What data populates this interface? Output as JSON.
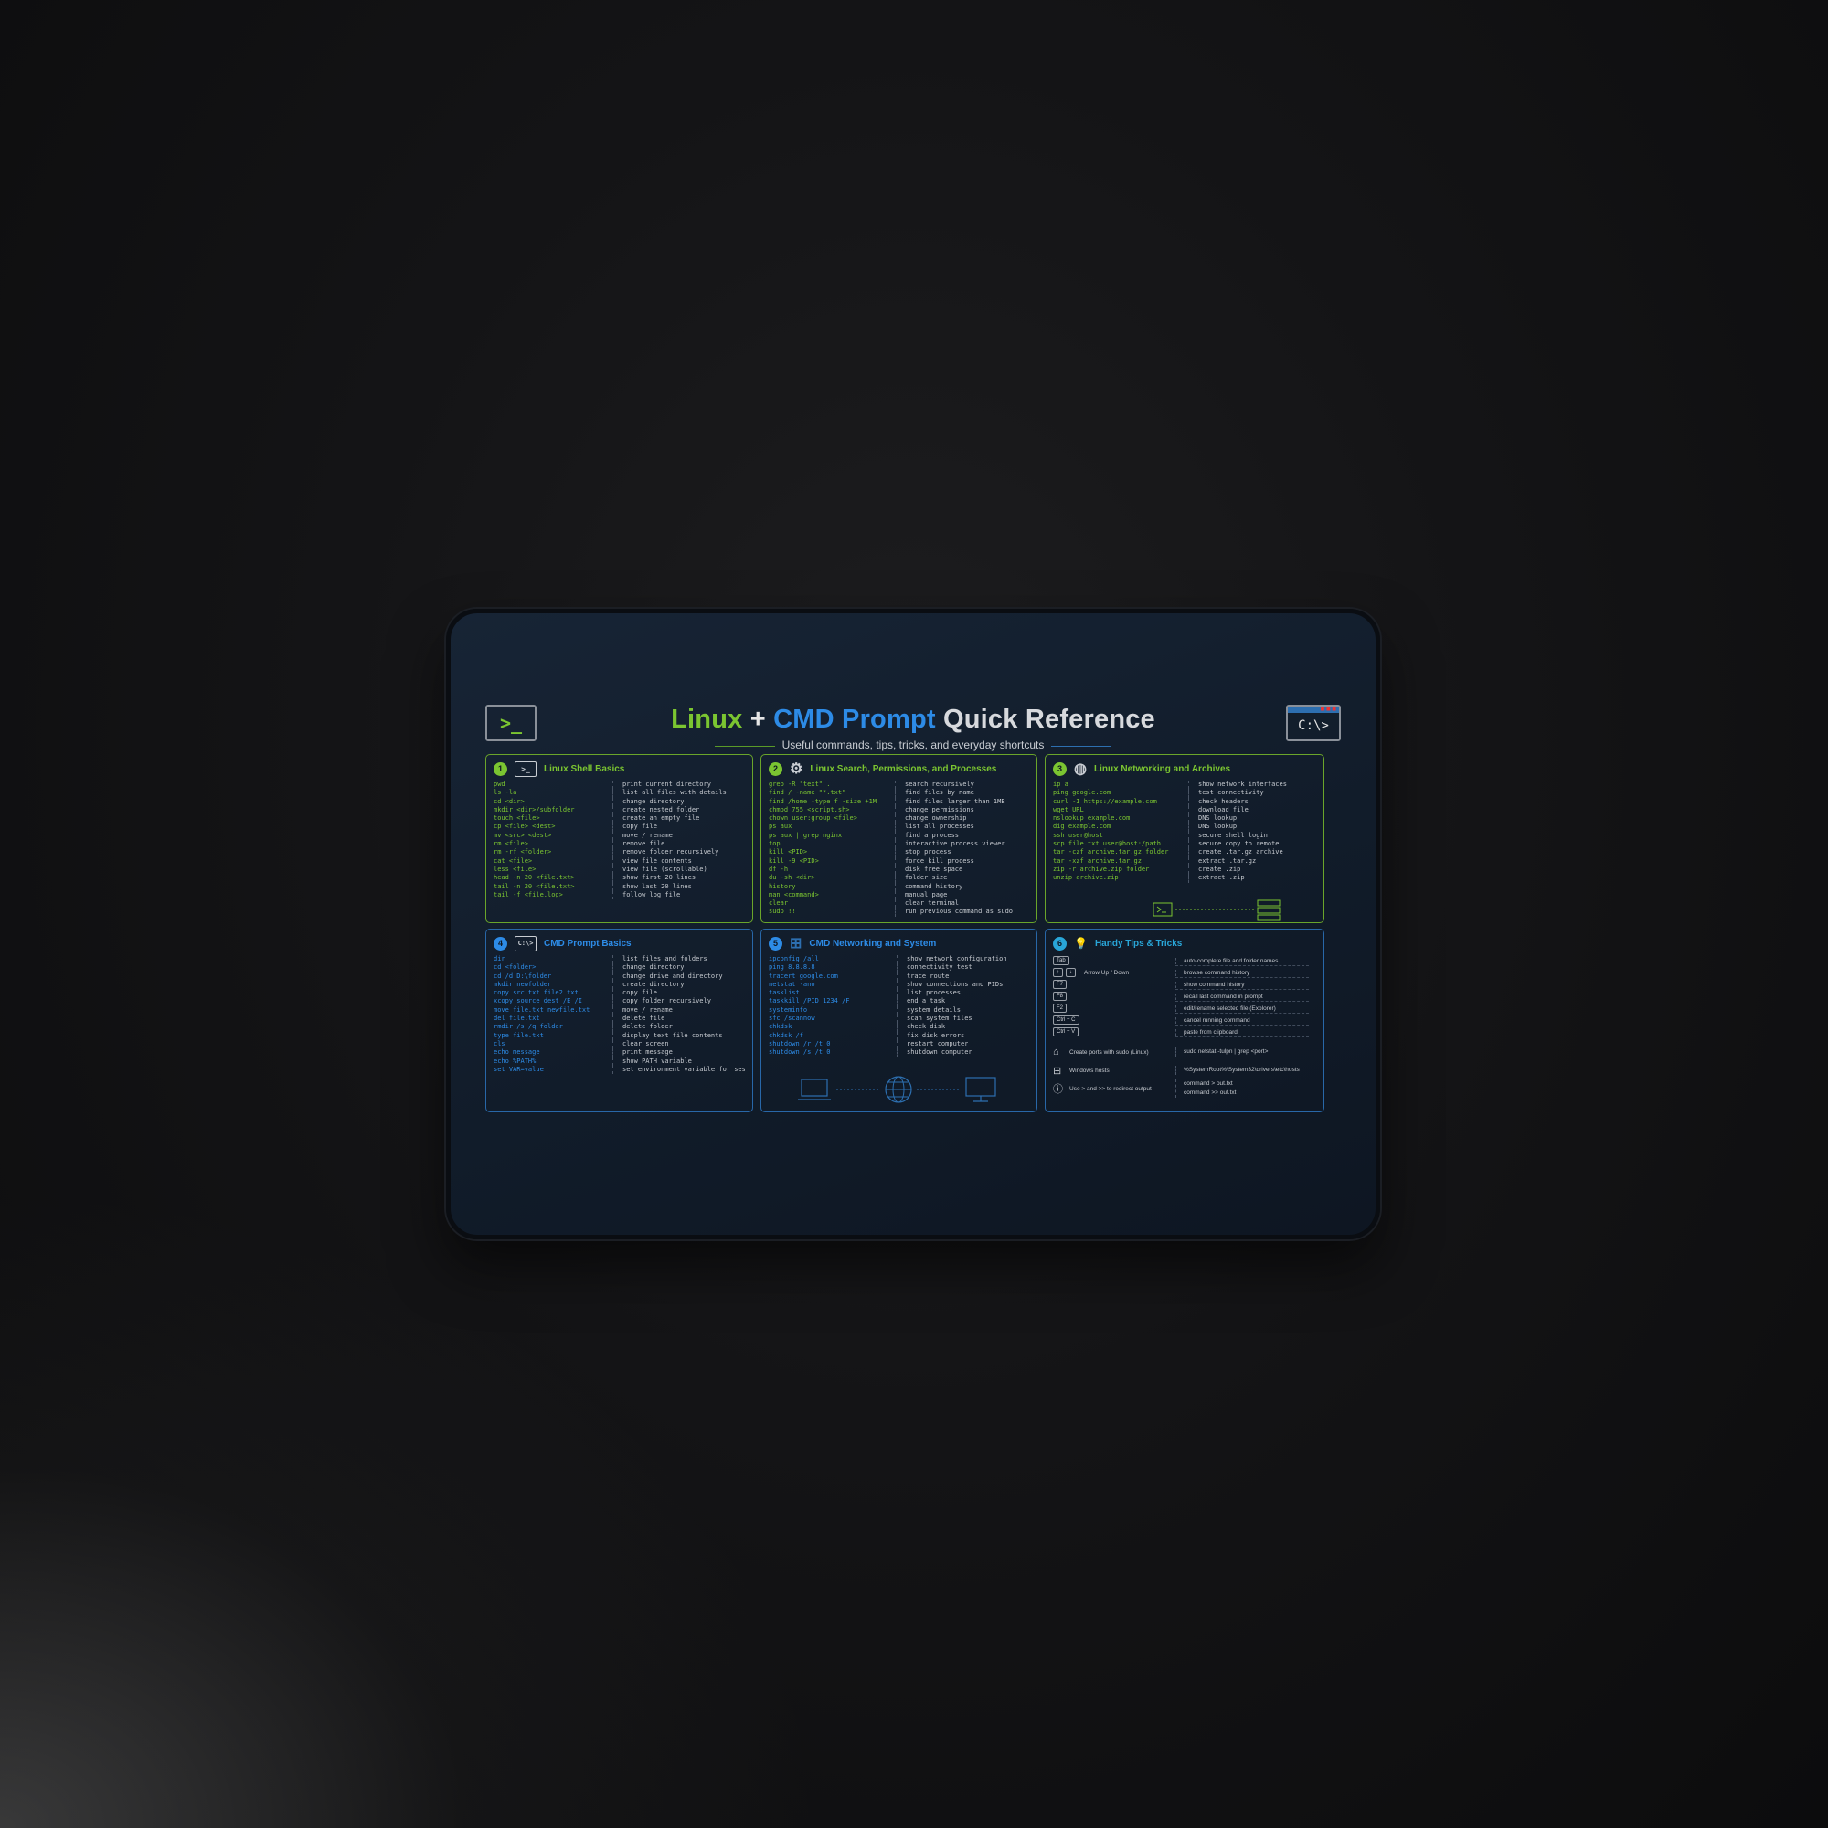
{
  "header": {
    "title_linux": "Linux",
    "title_plus": "+",
    "title_cmd": "CMD Prompt",
    "title_rest": "Quick Reference",
    "subtitle": "Useful commands, tips, tricks, and everyday shortcuts",
    "logo_left": ">_",
    "logo_right": "C:\\>"
  },
  "panels": [
    {
      "number": "1",
      "title": "Linux Shell Basics",
      "icon_text": ">_",
      "rows": [
        {
          "cmd": "pwd",
          "desc": "print current directory"
        },
        {
          "cmd": "ls -la",
          "desc": "list all files with details"
        },
        {
          "cmd": "cd <dir>",
          "desc": "change directory"
        },
        {
          "cmd": "mkdir <dir>/subfolder",
          "desc": "create nested folder"
        },
        {
          "cmd": "touch <file>",
          "desc": "create an empty file"
        },
        {
          "cmd": "cp <file> <dest>",
          "desc": "copy file"
        },
        {
          "cmd": "mv <src> <dest>",
          "desc": "move / rename"
        },
        {
          "cmd": "rm <file>",
          "desc": "remove file"
        },
        {
          "cmd": "rm -rf <folder>",
          "desc": "remove folder recursively"
        },
        {
          "cmd": "cat <file>",
          "desc": "view file contents"
        },
        {
          "cmd": "less <file>",
          "desc": "view file (scrollable)"
        },
        {
          "cmd": "head -n 20 <file.txt>",
          "desc": "show first 20 lines"
        },
        {
          "cmd": "tail -n 20 <file.txt>",
          "desc": "show last 20 lines"
        },
        {
          "cmd": "tail -f <file.log>",
          "desc": "follow log file"
        }
      ]
    },
    {
      "number": "2",
      "title": "Linux Search, Permissions, and Processes",
      "icon_text": "⚙",
      "rows": [
        {
          "cmd": "grep -R \"text\" .",
          "desc": "search recursively"
        },
        {
          "cmd": "find / -name \"*.txt\"",
          "desc": "find files by name"
        },
        {
          "cmd": "find /home -type f -size +1M",
          "desc": "find files larger than 1MB"
        },
        {
          "cmd": "chmod 755 <script.sh>",
          "desc": "change permissions"
        },
        {
          "cmd": "chown user:group <file>",
          "desc": "change ownership"
        },
        {
          "cmd": "ps aux",
          "desc": "list all processes"
        },
        {
          "cmd": "ps aux | grep nginx",
          "desc": "find a process"
        },
        {
          "cmd": "top",
          "desc": "interactive process viewer"
        },
        {
          "cmd": "kill <PID>",
          "desc": "stop process"
        },
        {
          "cmd": "kill -9 <PID>",
          "desc": "force kill process"
        },
        {
          "cmd": "df -h",
          "desc": "disk free space"
        },
        {
          "cmd": "du -sh <dir>",
          "desc": "folder size"
        },
        {
          "cmd": "history",
          "desc": "command history"
        },
        {
          "cmd": "man <command>",
          "desc": "manual page"
        },
        {
          "cmd": "clear",
          "desc": "clear terminal"
        },
        {
          "cmd": "sudo !!",
          "desc": "run previous command as sudo"
        }
      ]
    },
    {
      "number": "3",
      "title": "Linux Networking and Archives",
      "icon_text": "◍",
      "rows": [
        {
          "cmd": "ip a",
          "desc": "show network interfaces"
        },
        {
          "cmd": "ping google.com",
          "desc": "test connectivity"
        },
        {
          "cmd": "curl -I https://example.com",
          "desc": "check headers"
        },
        {
          "cmd": "wget URL",
          "desc": "download file"
        },
        {
          "cmd": "nslookup example.com",
          "desc": "DNS lookup"
        },
        {
          "cmd": "dig example.com",
          "desc": "DNS lookup"
        },
        {
          "cmd": "ssh user@host",
          "desc": "secure shell login"
        },
        {
          "cmd": "scp file.txt user@host:/path",
          "desc": "secure copy to remote"
        },
        {
          "cmd": "tar -czf archive.tar.gz folder",
          "desc": "create .tar.gz archive"
        },
        {
          "cmd": "tar -xzf archive.tar.gz",
          "desc": "extract .tar.gz"
        },
        {
          "cmd": "zip -r archive.zip folder",
          "desc": "create .zip"
        },
        {
          "cmd": "unzip archive.zip",
          "desc": "extract .zip"
        }
      ]
    },
    {
      "number": "4",
      "title": "CMD Prompt Basics",
      "icon_text": "C:\\>",
      "rows": [
        {
          "cmd": "dir",
          "desc": "list files and folders"
        },
        {
          "cmd": "cd <folder>",
          "desc": "change directory"
        },
        {
          "cmd": "cd /d D:\\folder",
          "desc": "change drive and directory"
        },
        {
          "cmd": "mkdir newfolder",
          "desc": "create directory"
        },
        {
          "cmd": "copy src.txt file2.txt",
          "desc": "copy file"
        },
        {
          "cmd": "xcopy source dest /E /I",
          "desc": "copy folder recursively"
        },
        {
          "cmd": "move file.txt newfile.txt",
          "desc": "move / rename"
        },
        {
          "cmd": "del file.txt",
          "desc": "delete file"
        },
        {
          "cmd": "rmdir /s /q folder",
          "desc": "delete folder"
        },
        {
          "cmd": "type file.txt",
          "desc": "display text file contents"
        },
        {
          "cmd": "cls",
          "desc": "clear screen"
        },
        {
          "cmd": "echo message",
          "desc": "print message"
        },
        {
          "cmd": "echo %PATH%",
          "desc": "show PATH variable"
        },
        {
          "cmd": "set VAR=value",
          "desc": "set environment variable for session"
        }
      ]
    },
    {
      "number": "5",
      "title": "CMD Networking and System",
      "icon_text": "⊞",
      "rows": [
        {
          "cmd": "ipconfig /all",
          "desc": "show network configuration"
        },
        {
          "cmd": "ping 8.8.8.8",
          "desc": "connectivity test"
        },
        {
          "cmd": "tracert google.com",
          "desc": "trace route"
        },
        {
          "cmd": "netstat -ano",
          "desc": "show connections and PIDs"
        },
        {
          "cmd": "tasklist",
          "desc": "list processes"
        },
        {
          "cmd": "taskkill /PID 1234 /F",
          "desc": "end a task"
        },
        {
          "cmd": "systeminfo",
          "desc": "system details"
        },
        {
          "cmd": "sfc /scannow",
          "desc": "scan system files"
        },
        {
          "cmd": "chkdsk",
          "desc": "check disk"
        },
        {
          "cmd": "chkdsk /f",
          "desc": "fix disk errors"
        },
        {
          "cmd": "shutdown /r /t 0",
          "desc": "restart computer"
        },
        {
          "cmd": "shutdown /s /t 0",
          "desc": "shutdown computer"
        }
      ]
    },
    {
      "number": "6",
      "title": "Handy Tips & Tricks",
      "icon_text": "💡",
      "tips": [
        {
          "keys": [
            "Tab"
          ],
          "label": "",
          "desc": "auto-complete file and folder names"
        },
        {
          "keys": [
            "↑",
            "↓"
          ],
          "label": "Arrow Up / Down",
          "desc": "browse command history"
        },
        {
          "keys": [
            "F7"
          ],
          "label": "",
          "desc": "show command history"
        },
        {
          "keys": [
            "F8"
          ],
          "label": "",
          "desc": "recall last command in prompt"
        },
        {
          "keys": [
            "F2"
          ],
          "label": "",
          "desc": "edit/rename selected file (Explorer)"
        },
        {
          "keys": [
            "Ctrl + C"
          ],
          "label": "",
          "desc": "cancel running command"
        },
        {
          "keys": [
            "Ctrl + V"
          ],
          "label": "",
          "desc": "paste from clipboard"
        }
      ],
      "extras": [
        {
          "icon": "⌂",
          "label": "Create ports with sudo (Linux)",
          "desc": "sudo netstat -tulpn | grep <port>"
        },
        {
          "icon": "⊞",
          "label": "Windows hosts",
          "desc": "%SystemRoot%\\System32\\drivers\\etc\\hosts"
        },
        {
          "icon": "ⓘ",
          "label": "Use > and >> to redirect output",
          "desc": "command > out.txt",
          "desc2": "command >> out.txt"
        }
      ]
    }
  ],
  "colors": {
    "linux_green": "#7bc531",
    "cmd_blue": "#2d8be6",
    "pad_bg": "#131e2c"
  }
}
